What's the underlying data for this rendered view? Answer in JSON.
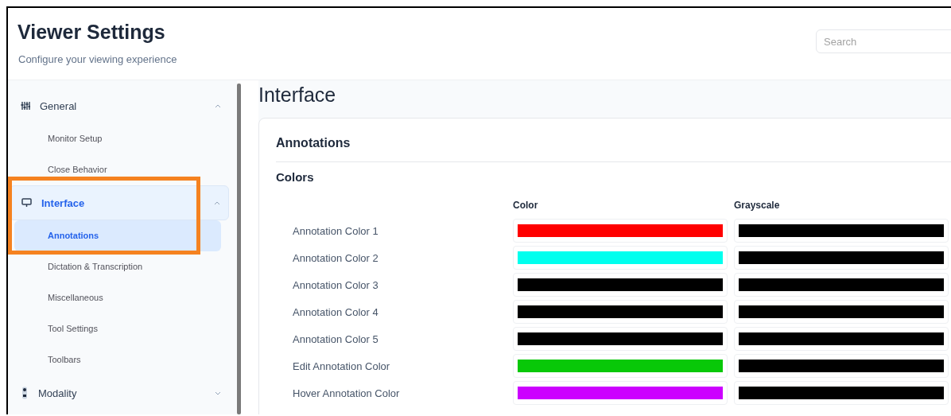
{
  "header": {
    "title": "Viewer Settings",
    "subtitle": "Configure your viewing experience",
    "search": {
      "placeholder": "Search"
    }
  },
  "sidebar": {
    "groups": [
      {
        "label": "General",
        "kind": "sliders",
        "expanded": true,
        "selected": false,
        "children": [
          {
            "label": "Monitor Setup",
            "selected": false
          },
          {
            "label": "Close Behavior",
            "selected": false
          }
        ]
      },
      {
        "label": "Interface",
        "kind": "monitor",
        "expanded": true,
        "selected": true,
        "children": [
          {
            "label": "Annotations",
            "selected": true
          },
          {
            "label": "Dictation & Transcription",
            "selected": false
          },
          {
            "label": "Miscellaneous",
            "selected": false
          },
          {
            "label": "Tool Settings",
            "selected": false
          },
          {
            "label": "Toolbars",
            "selected": false
          }
        ]
      },
      {
        "label": "Modality",
        "kind": "device",
        "expanded": false,
        "selected": false
      }
    ]
  },
  "page_title": "Interface",
  "card": {
    "title": "Annotations",
    "section": "Colors",
    "columns": [
      "Color",
      "Grayscale"
    ],
    "rows": [
      {
        "label": "Annotation Color 1",
        "color": "#ff0000",
        "grayscale": {
          "color": "#000000"
        }
      },
      {
        "label": "Annotation Color 2",
        "color": "#00ffee",
        "grayscale": {
          "color": "#000000"
        }
      },
      {
        "label": "Annotation Color 3",
        "color": "#000000",
        "grayscale": {
          "color": "#000000"
        }
      },
      {
        "label": "Annotation Color 4",
        "color": "#000000",
        "grayscale": {
          "color": "#000000"
        }
      },
      {
        "label": "Annotation Color 5",
        "color": "#000000",
        "grayscale": {
          "color": "#000000"
        }
      },
      {
        "label": "Edit Annotation Color",
        "color": "#08c808",
        "grayscale": {
          "color": "#000000"
        }
      },
      {
        "label": "Hover Annotation Color",
        "color": "#cc00ff",
        "grayscale": {
          "color": "#000000"
        }
      }
    ]
  }
}
